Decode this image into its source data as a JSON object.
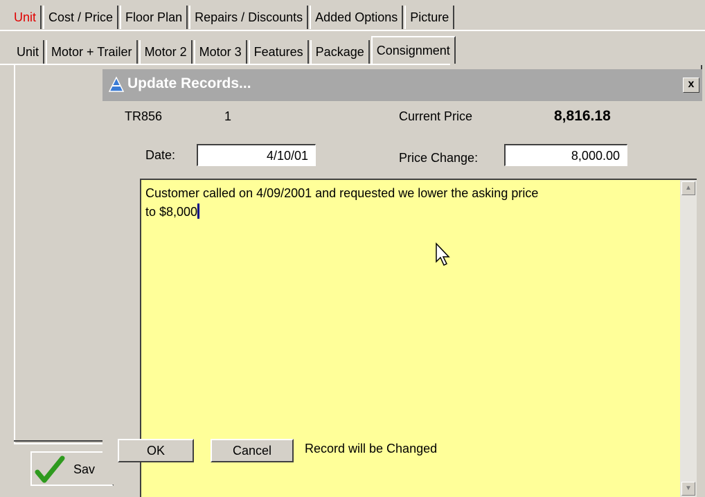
{
  "tabs_row1": [
    "Unit",
    "Cost / Price",
    "Floor Plan",
    "Repairs / Discounts",
    "Added Options",
    "Picture"
  ],
  "tabs_row2": [
    "Unit",
    "Motor + Trailer",
    "Motor 2",
    "Motor 3",
    "Features",
    "Package",
    "Consignment"
  ],
  "background_button": {
    "label": "Sav"
  },
  "dialog": {
    "title": "Update Records...",
    "close": "x",
    "record_id": "TR856",
    "record_num": "1",
    "current_price_label": "Current Price",
    "current_price": "8,816.18",
    "date_label": "Date:",
    "date_value": "4/10/01",
    "price_change_label": "Price Change:",
    "price_change_value": "8,000.00",
    "memo_line1": "Customer called on 4/09/2001 and requested we lower the asking price",
    "memo_line2": "to $8,000",
    "ok_label": "OK",
    "cancel_label": "Cancel",
    "status": "Record will be Changed"
  },
  "colors": {
    "active_red": "#e00000",
    "memo_bg": "#ffff99",
    "title_bg": "#a8a8a8"
  }
}
